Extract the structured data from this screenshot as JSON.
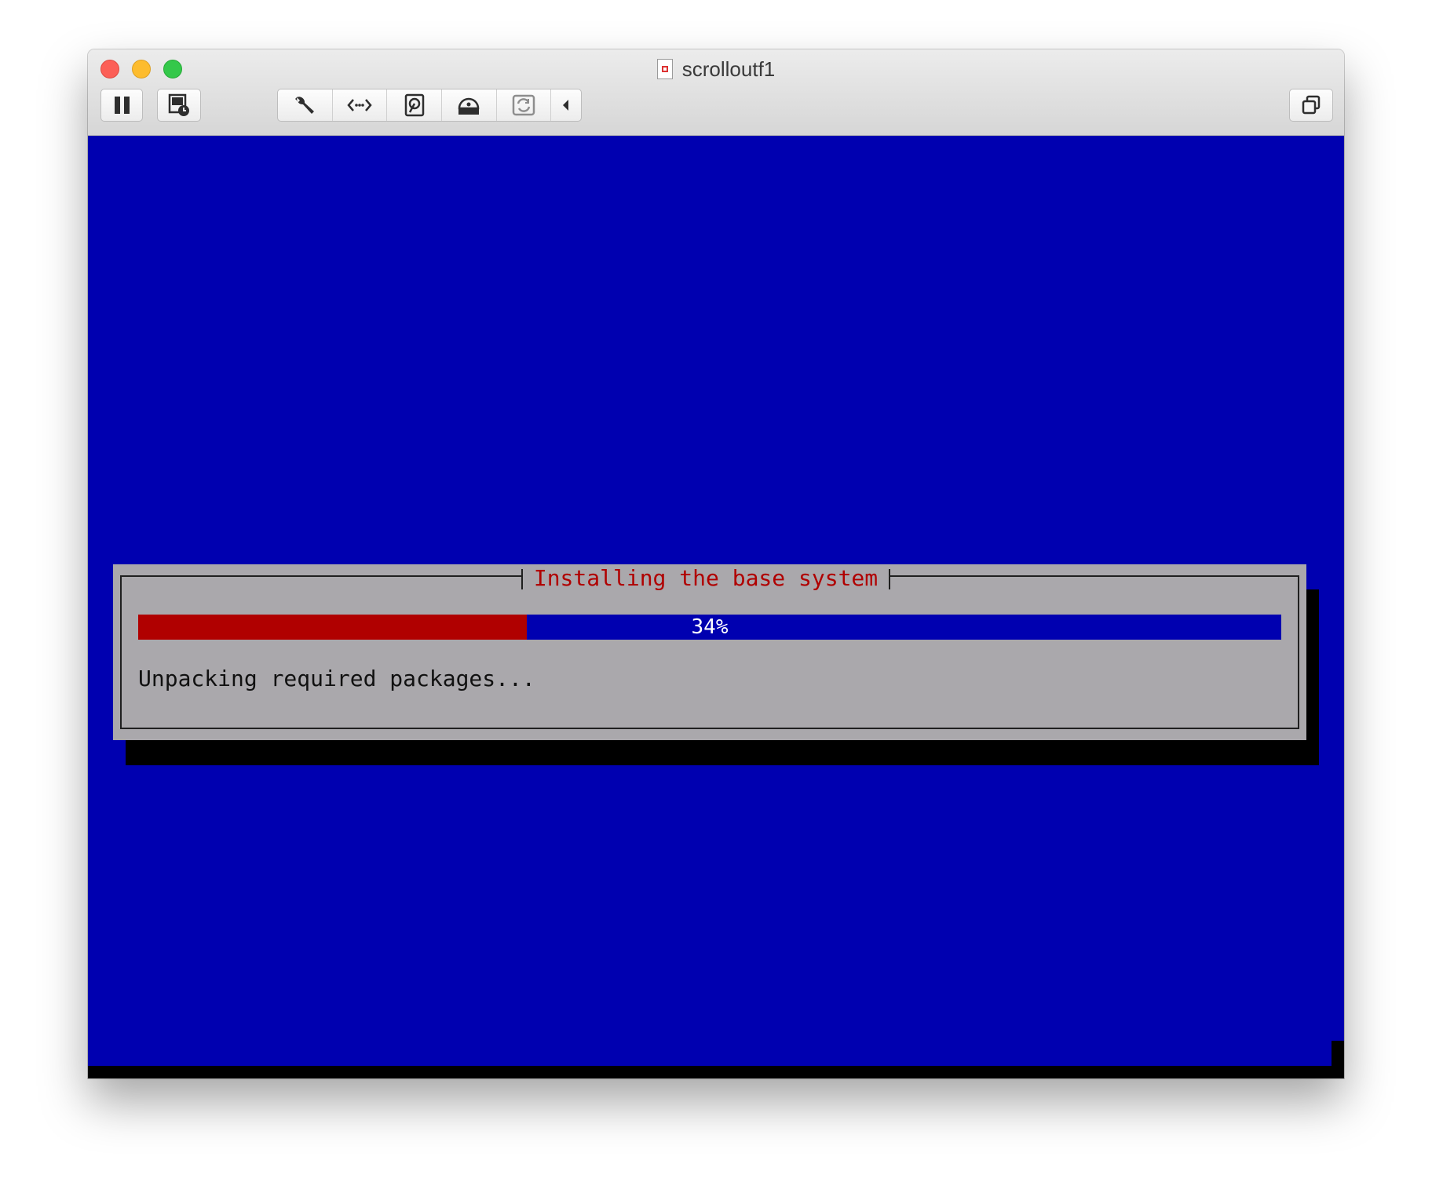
{
  "window": {
    "title": "scrolloutf1"
  },
  "toolbar": {
    "pause_icon": "pause-icon",
    "snapshot_icon": "snapshot-clock-icon",
    "settings_icon": "wrench-icon",
    "network_icon": "network-arrows-icon",
    "disk_icon": "hard-disk-icon",
    "optical_icon": "optical-drive-icon",
    "usb_icon": "sync-icon",
    "collapse_icon": "chevron-left-icon",
    "fullscreen_icon": "restore-windows-icon"
  },
  "colors": {
    "screen_bg": "#0000b0",
    "dialog_bg": "#aaa8ac",
    "title_red": "#b00000",
    "progress_fill": "#b00000"
  },
  "installer": {
    "dialog_title": "Installing the base system",
    "progress_percent": 34,
    "progress_label": "34%",
    "status": "Unpacking required packages..."
  }
}
